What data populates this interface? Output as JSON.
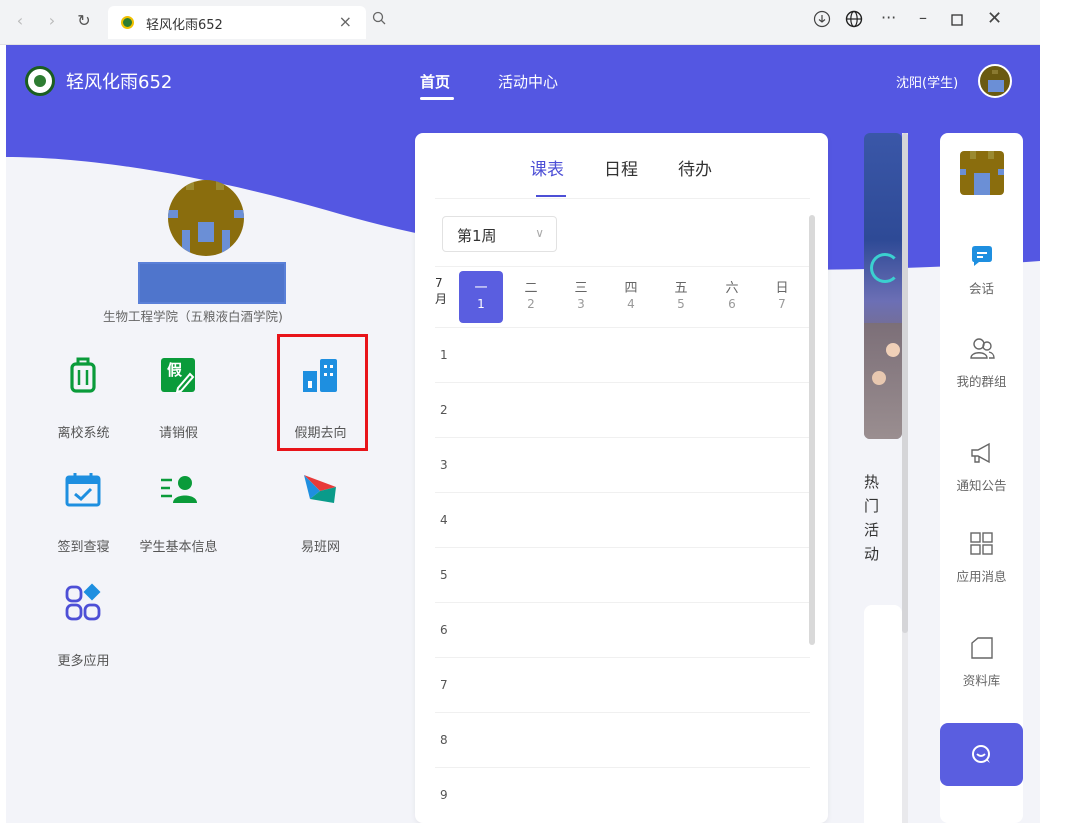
{
  "browser": {
    "tab_title": "轻风化雨652",
    "tab_close": "×"
  },
  "header": {
    "app_title": "轻风化雨652",
    "nav": [
      "首页",
      "活动中心"
    ],
    "user_name": "沈阳(学生)"
  },
  "profile": {
    "college": "生物工程学院（五粮液白酒学院)"
  },
  "apps": [
    {
      "label": "离校系统",
      "icon": "luggage-icon"
    },
    {
      "label": "请销假",
      "icon": "leave-request-icon",
      "glyph": "假"
    },
    {
      "label": "假期去向",
      "icon": "building-icon"
    },
    {
      "label": "签到查寝",
      "icon": "calendar-check-icon"
    },
    {
      "label": "学生基本信息",
      "icon": "student-info-icon"
    },
    {
      "label": "易班网",
      "icon": "yiban-logo-icon"
    },
    {
      "label": "更多应用",
      "icon": "more-apps-icon"
    }
  ],
  "schedule": {
    "tabs": [
      "课表",
      "日程",
      "待办"
    ],
    "active_tab": 0,
    "week": "第1周",
    "month_top": "7",
    "month_bottom": "月",
    "days": [
      {
        "name": "一",
        "num": "1"
      },
      {
        "name": "二",
        "num": "2"
      },
      {
        "name": "三",
        "num": "3"
      },
      {
        "name": "四",
        "num": "4"
      },
      {
        "name": "五",
        "num": "5"
      },
      {
        "name": "六",
        "num": "6"
      },
      {
        "name": "日",
        "num": "7"
      }
    ],
    "active_day": 0,
    "periods": [
      "1",
      "2",
      "3",
      "4",
      "5",
      "6",
      "7",
      "8",
      "9"
    ]
  },
  "hot": {
    "title_chars": [
      "热",
      "门",
      "活",
      "动"
    ]
  },
  "sidebar": [
    {
      "label": "会话",
      "icon": "chat-bubble-icon"
    },
    {
      "label": "我的群组",
      "icon": "group-icon"
    },
    {
      "label": "通知公告",
      "icon": "megaphone-icon"
    },
    {
      "label": "应用消息",
      "icon": "app-grid-icon"
    },
    {
      "label": "资料库",
      "icon": "folder-icon"
    }
  ],
  "colors": {
    "primary": "#5a5ee0",
    "header_bg": "#5457e2",
    "highlight_box": "#e8141a"
  }
}
